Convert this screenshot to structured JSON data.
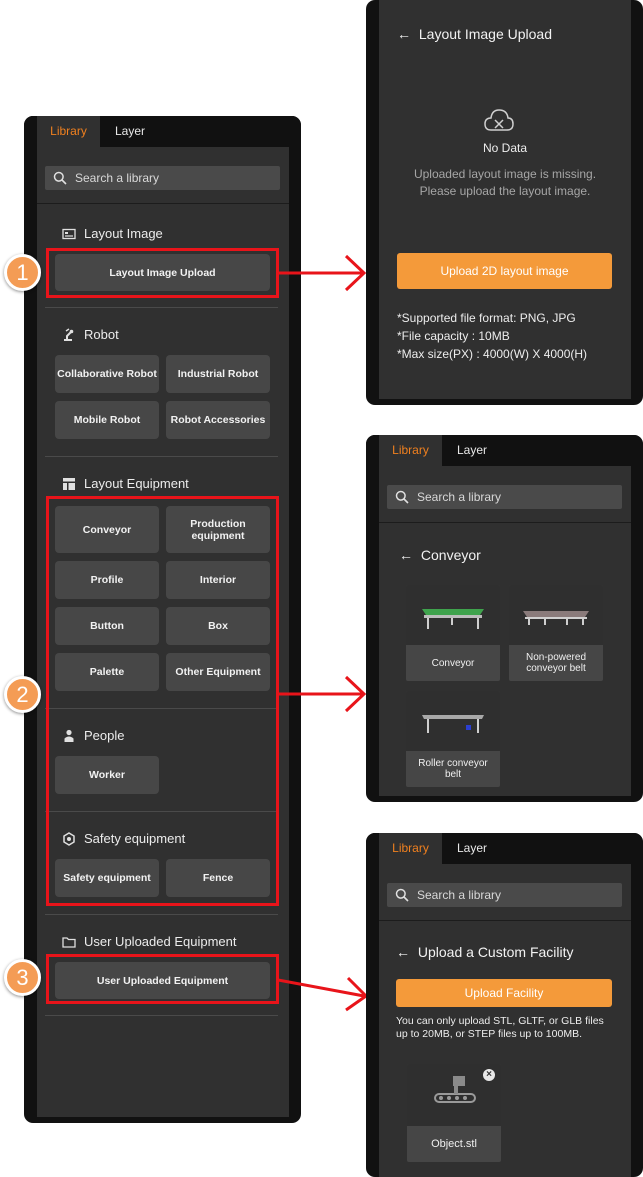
{
  "main_panel": {
    "tabs": [
      {
        "label": "Library"
      },
      {
        "label": "Layer"
      }
    ],
    "search_placeholder": "Search a library",
    "sections": {
      "layout_image": {
        "title": "Layout Image",
        "buttons": [
          "Layout Image Upload"
        ]
      },
      "robot": {
        "title": "Robot",
        "buttons": [
          "Collaborative Robot",
          "Industrial Robot",
          "Mobile Robot",
          "Robot Accessories"
        ]
      },
      "layout_equipment": {
        "title": "Layout Equipment",
        "buttons": [
          "Conveyor",
          "Production equipment",
          "Profile",
          "Interior",
          "Button",
          "Box",
          "Palette",
          "Other Equipment"
        ]
      },
      "people": {
        "title": "People",
        "buttons": [
          "Worker"
        ]
      },
      "safety": {
        "title": "Safety equipment",
        "buttons": [
          "Safety equipment",
          "Fence"
        ]
      },
      "user_uploaded": {
        "title": "User Uploaded Equipment",
        "buttons": [
          "User Uploaded Equipment"
        ]
      }
    }
  },
  "callouts": [
    "1",
    "2",
    "3"
  ],
  "upload_panel": {
    "title": "Layout Image Upload",
    "no_data": "No Data",
    "message_line1": "Uploaded layout image is missing.",
    "message_line2": "Please upload the layout image.",
    "button": "Upload 2D layout image",
    "info": [
      "*Supported file format: PNG, JPG",
      "*File capacity : 10MB",
      "*Max size(PX) : 4000(W) X 4000(H)"
    ]
  },
  "conveyor_panel": {
    "tabs": [
      {
        "label": "Library"
      },
      {
        "label": "Layer"
      }
    ],
    "search_placeholder": "Search a library",
    "title": "Conveyor",
    "items": [
      "Conveyor",
      "Non-powered conveyor belt",
      "Roller conveyor belt"
    ]
  },
  "custom_panel": {
    "tabs": [
      {
        "label": "Library"
      },
      {
        "label": "Layer"
      }
    ],
    "search_placeholder": "Search a library",
    "title": "Upload a Custom Facility",
    "button": "Upload Facility",
    "note_line1": "You can only upload STL, GLTF, or GLB files",
    "note_line2": "up to 20MB, or STEP files up to 100MB.",
    "file_name": "Object.stl"
  },
  "colors": {
    "accent": "#f49a3a",
    "highlight": "#e8141a",
    "panel_bg": "#303030",
    "frame": "#111111"
  }
}
